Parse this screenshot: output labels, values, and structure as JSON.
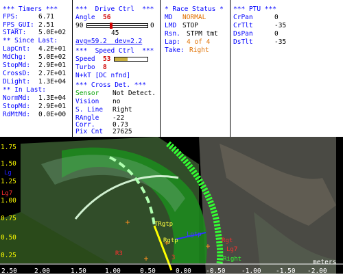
{
  "timers": {
    "header": "*** Timers ***",
    "fps_label": "FPS:",
    "fps": "6.71",
    "fps_gui_label": "FPS_GUI:",
    "fps_gui": "2.51",
    "start_label": "START:",
    "start": "5.0E+02",
    "since_last_header": "** Since Last:",
    "lapcnt_label": "LapCnt:",
    "lapcnt": "4.2E+01",
    "mdchg_label": "MdChg:",
    "mdchg": "5.0E+02",
    "stopmd_label": "StopMd:",
    "stopmd": "2.9E+01",
    "crossd_label": "CrossD:",
    "crossd": "2.7E+01",
    "dlight_label": "DLight:",
    "dlight": "1.3E+04",
    "in_last_header": "** In Last:",
    "normmd_label": "NormMd:",
    "normmd": "1.3E+04",
    "stopmd2_label": "StopMd:",
    "stopmd2": "2.9E+01",
    "rdmtmd_label": "RdMtMd:",
    "rdmtmd": "0.0E+00"
  },
  "drive": {
    "header": "***  Drive Ctrl  ***",
    "angle_label": "Angle",
    "angle": "56",
    "scale_min": "90",
    "scale_max": "0",
    "scale_mid": "45",
    "angle_fraction": 0.38,
    "avg_text": "avg=59.2  dev=2.2",
    "speed_header": "***  Speed Ctrl  ***",
    "speed_label": "Speed",
    "speed": "53",
    "speed_fraction": 0.4,
    "turbo_label": "Turbo",
    "turbo": "8",
    "nkt_text": "N+kT [DC nfnd]",
    "cross_header": "*** Cross Det. ***",
    "sensor_label": "Sensor",
    "sensor": "Not Detect.",
    "vision_label": "Vision",
    "vision": "no",
    "sline_label": "S. Line",
    "sline": "Right",
    "rangle_label": "RAngle",
    "rangle": "-22",
    "corr_label": "Corr.",
    "corr": "0.73",
    "pixcnt_label": "Pix Cnt",
    "pixcnt": "27625"
  },
  "race": {
    "header": "* Race Status *",
    "md_label": "MD",
    "md": "NORMAL",
    "lmd_label": "LMD",
    "lmd": "STOP",
    "rsn_label": "Rsn.",
    "rsn": "STPM tmt",
    "lap_label": "Lap:",
    "lap": "4 of 4",
    "take_label": "Take:",
    "take": "Right"
  },
  "ptu": {
    "header": "*** PTU ***",
    "crpan_label": "CrPan",
    "crpan": "0",
    "crtilt_label": "CrTlt",
    "crtilt": "-35",
    "dspan_label": "DsPan",
    "dspan": "0",
    "dstilt_label": "DsTlt",
    "dstilt": "-35"
  },
  "viewport": {
    "y_ticks": [
      "1.75",
      "1.50",
      "1.25",
      "1.00",
      "0.75",
      "0.50",
      "0.25"
    ],
    "x_ticks": [
      "2.50",
      "2.00",
      "1.50",
      "1.00",
      "0.50",
      "0.00",
      "-0.50",
      "-1.00",
      "-1.50",
      "-2.00"
    ],
    "units": "meters",
    "markers": {
      "trgtp": "TRgtp",
      "rgtp": "Rgtp",
      "lgtp": "Lgtp",
      "rgt": "Rgt",
      "lg": "Lg",
      "lg7": "Lg7",
      "lg7b": "Lg7",
      "r3": "R3",
      "n3": "3",
      "right": "Right"
    },
    "colors": {
      "track": "#30c030",
      "line": "#33ff33",
      "ground": "#2a4a1a"
    }
  }
}
